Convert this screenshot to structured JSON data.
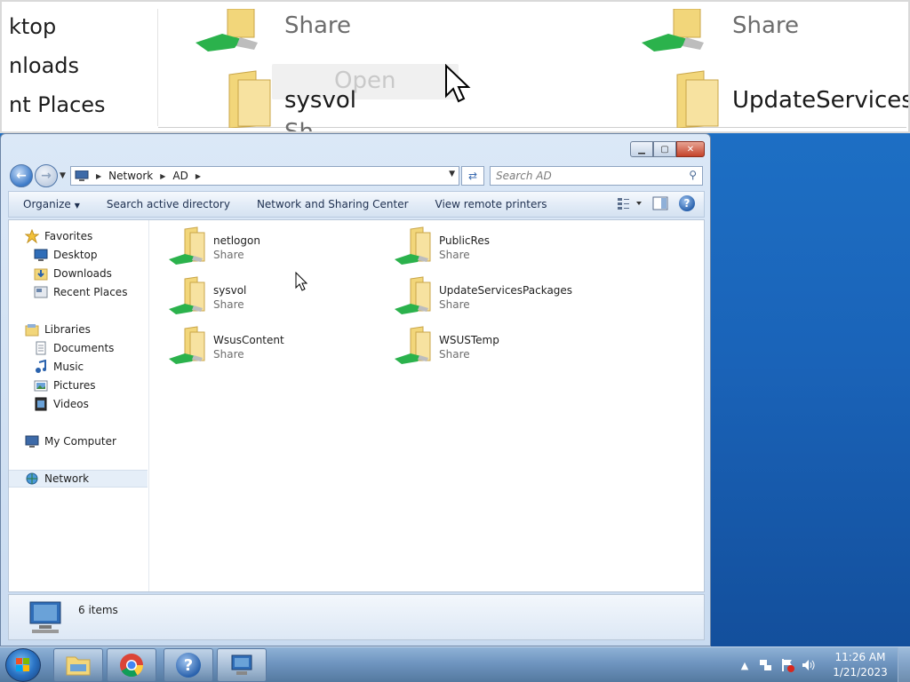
{
  "zoom": {
    "nav_items": [
      "ktop",
      "nloads",
      "nt Places"
    ],
    "items": [
      {
        "name": "Share"
      },
      {
        "name": "Share"
      },
      {
        "name": "sysvol"
      },
      {
        "name": "UpdateServicesPac"
      },
      {
        "name": "Sh"
      }
    ],
    "open_label": "Open"
  },
  "window": {
    "caption_buttons": {
      "minimize": "minimize",
      "maximize": "maximize",
      "close": "close"
    },
    "address": {
      "crumbs": [
        "Network",
        "AD"
      ]
    },
    "search": {
      "placeholder": "Search AD"
    },
    "toolbar": {
      "organize": "Organize",
      "search_ad": "Search active directory",
      "network_center": "Network and Sharing Center",
      "remote_printers": "View remote printers"
    },
    "sidebar": {
      "favorites": "Favorites",
      "desktop": "Desktop",
      "downloads": "Downloads",
      "recent_places": "Recent Places",
      "libraries": "Libraries",
      "documents": "Documents",
      "music": "Music",
      "pictures": "Pictures",
      "videos": "Videos",
      "my_computer": "My Computer",
      "network": "Network"
    },
    "items": [
      {
        "name": "netlogon",
        "type": "Share"
      },
      {
        "name": "PublicRes",
        "type": "Share"
      },
      {
        "name": "sysvol",
        "type": "Share"
      },
      {
        "name": "UpdateServicesPackages",
        "type": "Share"
      },
      {
        "name": "WsusContent",
        "type": "Share"
      },
      {
        "name": "WSUSTemp",
        "type": "Share"
      }
    ],
    "details": {
      "count": "6 items"
    }
  },
  "taskbar": {
    "clock_time": "11:26 AM",
    "clock_date": "1/21/2023"
  },
  "colors": {
    "desktop": "#1a63b8",
    "folder": "#f2d67a",
    "share_cable": "#2bb24c"
  }
}
